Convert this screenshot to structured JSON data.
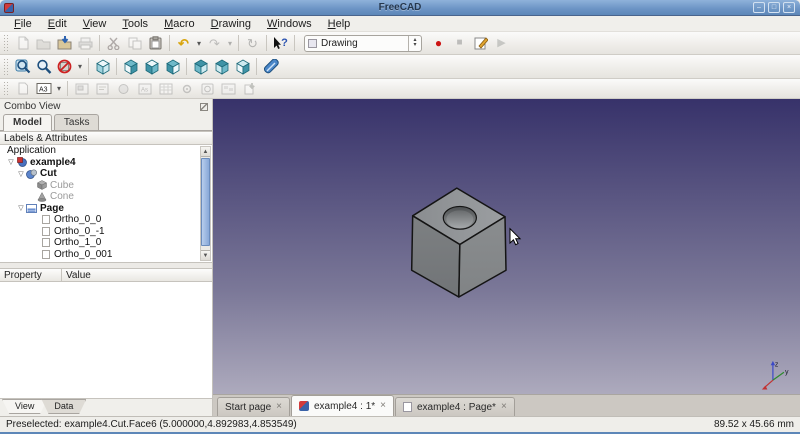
{
  "window": {
    "title": "FreeCAD"
  },
  "icons": {
    "minimize": "–",
    "maximize": "□",
    "close_window": "×",
    "close_tab": "×",
    "undo": "↶",
    "redo": "↷",
    "refresh": "↻",
    "dropdown": "▾",
    "spin_up": "▴",
    "spin_down": "▾",
    "scroll_up": "▲",
    "scroll_down": "▼",
    "expander_open": "▽",
    "record": "●",
    "stop": "■",
    "play": "▶",
    "whatsthis_q": "?",
    "a3": "A3"
  },
  "menu": {
    "items": [
      "File",
      "Edit",
      "View",
      "Tools",
      "Macro",
      "Drawing",
      "Windows",
      "Help"
    ]
  },
  "toolbar": {
    "workbench": "Drawing"
  },
  "combo_view": {
    "title": "Combo View",
    "tabs": [
      "Model",
      "Tasks"
    ],
    "tree_header": "Labels & Attributes",
    "tree": [
      {
        "label": "Application"
      },
      {
        "label": "example4"
      },
      {
        "label": "Cut"
      },
      {
        "label": "Cube"
      },
      {
        "label": "Cone"
      },
      {
        "label": "Page"
      },
      {
        "label": "Ortho_0_0"
      },
      {
        "label": "Ortho_0_-1"
      },
      {
        "label": "Ortho_1_0"
      },
      {
        "label": "Ortho_0_001"
      }
    ],
    "property_columns": [
      "Property",
      "Value"
    ],
    "bottom_tabs": [
      "View",
      "Data"
    ]
  },
  "viewport": {
    "axis": {
      "x": "x",
      "y": "y",
      "z": "z"
    },
    "colors": {
      "gradient_top": "#37326a",
      "gradient_bottom": "#adaabd",
      "cube_top": "#909396",
      "cube_left": "#787b7d",
      "cube_right": "#868a8c"
    }
  },
  "document_tabs": [
    {
      "label": "Start page"
    },
    {
      "label": "example4 : 1*"
    },
    {
      "label": "example4 : Page*"
    }
  ],
  "status": {
    "message": "Preselected: example4.Cut.Face6 (5.000000,4.892983,4.853549)",
    "dimensions": "89.52 x 45.66 mm"
  }
}
